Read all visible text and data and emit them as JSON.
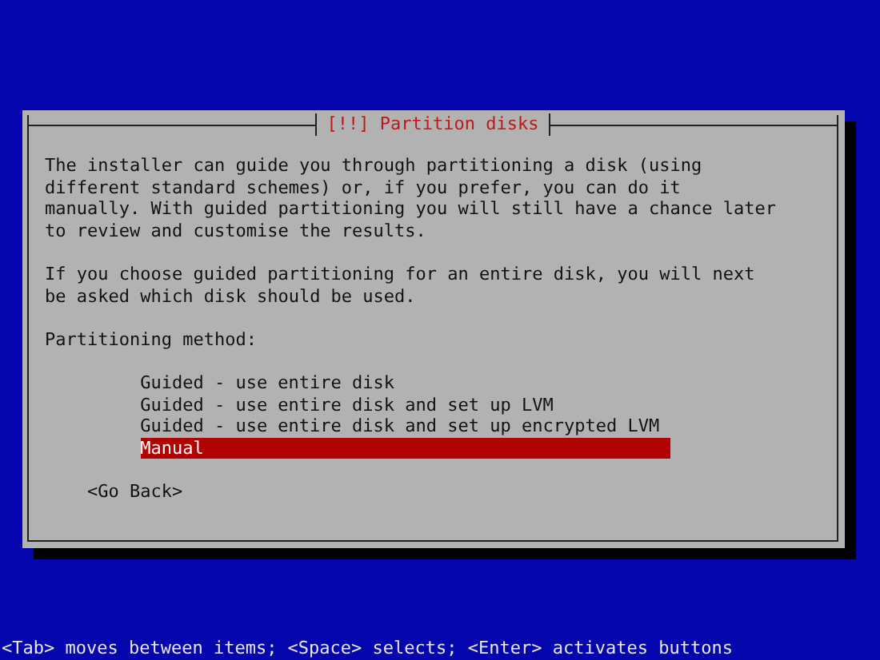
{
  "dialog": {
    "title": "[!!] Partition disks",
    "paragraphs": [
      "The installer can guide you through partitioning a disk (using different standard schemes) or, if you prefer, you can do it manually. With guided partitioning you will still have a chance later to review and customise the results.",
      "If you choose guided partitioning for an entire disk, you will next be asked which disk should be used."
    ],
    "list_label": "Partitioning method:",
    "options": [
      {
        "label": "Guided - use entire disk",
        "selected": false
      },
      {
        "label": "Guided - use entire disk and set up LVM",
        "selected": false
      },
      {
        "label": "Guided - use entire disk and set up encrypted LVM",
        "selected": false
      },
      {
        "label": "Manual",
        "selected": true
      }
    ],
    "back_button": "<Go Back>"
  },
  "status_bar": "<Tab> moves between items; <Space> selects; <Enter> activates buttons"
}
